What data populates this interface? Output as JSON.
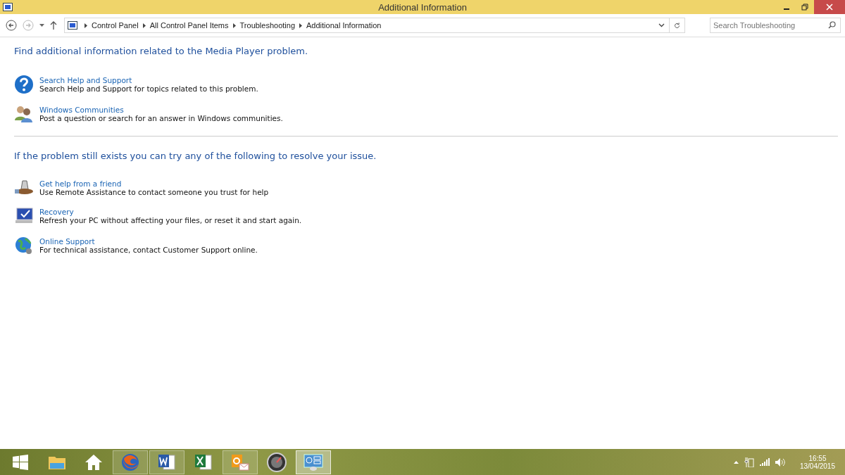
{
  "window": {
    "title": "Additional Information"
  },
  "address_bar": {
    "breadcrumbs": [
      "Control Panel",
      "All Control Panel Items",
      "Troubleshooting",
      "Additional Information"
    ]
  },
  "search": {
    "placeholder": "Search Troubleshooting"
  },
  "sections": [
    {
      "heading": "Find additional information related to the Media Player problem.",
      "items": [
        {
          "kind": "help",
          "title": "Search Help and Support",
          "description": "Search Help and Support for topics related to this problem."
        },
        {
          "kind": "community",
          "title": "Windows Communities",
          "description": "Post a question or search for an answer in Windows communities."
        }
      ]
    },
    {
      "heading": "If the problem still exists you can try any of the following to resolve your issue.",
      "items": [
        {
          "kind": "friend",
          "title": "Get help from a friend",
          "description": "Use Remote Assistance to contact someone you trust for help"
        },
        {
          "kind": "recovery",
          "title": "Recovery",
          "description": "Refresh your PC without affecting your files, or reset it and start again."
        },
        {
          "kind": "globe",
          "title": "Online Support",
          "description": "For technical assistance, contact Customer Support online."
        }
      ]
    }
  ],
  "taskbar": {
    "apps": [
      {
        "kind": "start",
        "open": false,
        "selected": false
      },
      {
        "kind": "folder",
        "open": false,
        "selected": false
      },
      {
        "kind": "home",
        "open": false,
        "selected": false
      },
      {
        "kind": "firefox",
        "open": true,
        "selected": false
      },
      {
        "kind": "word",
        "open": true,
        "selected": false
      },
      {
        "kind": "excel",
        "open": false,
        "selected": false
      },
      {
        "kind": "outlook",
        "open": true,
        "selected": false
      },
      {
        "kind": "dial",
        "open": false,
        "selected": false
      },
      {
        "kind": "panel",
        "open": true,
        "selected": true
      }
    ],
    "time": "16:55",
    "date": "13/04/2015"
  }
}
